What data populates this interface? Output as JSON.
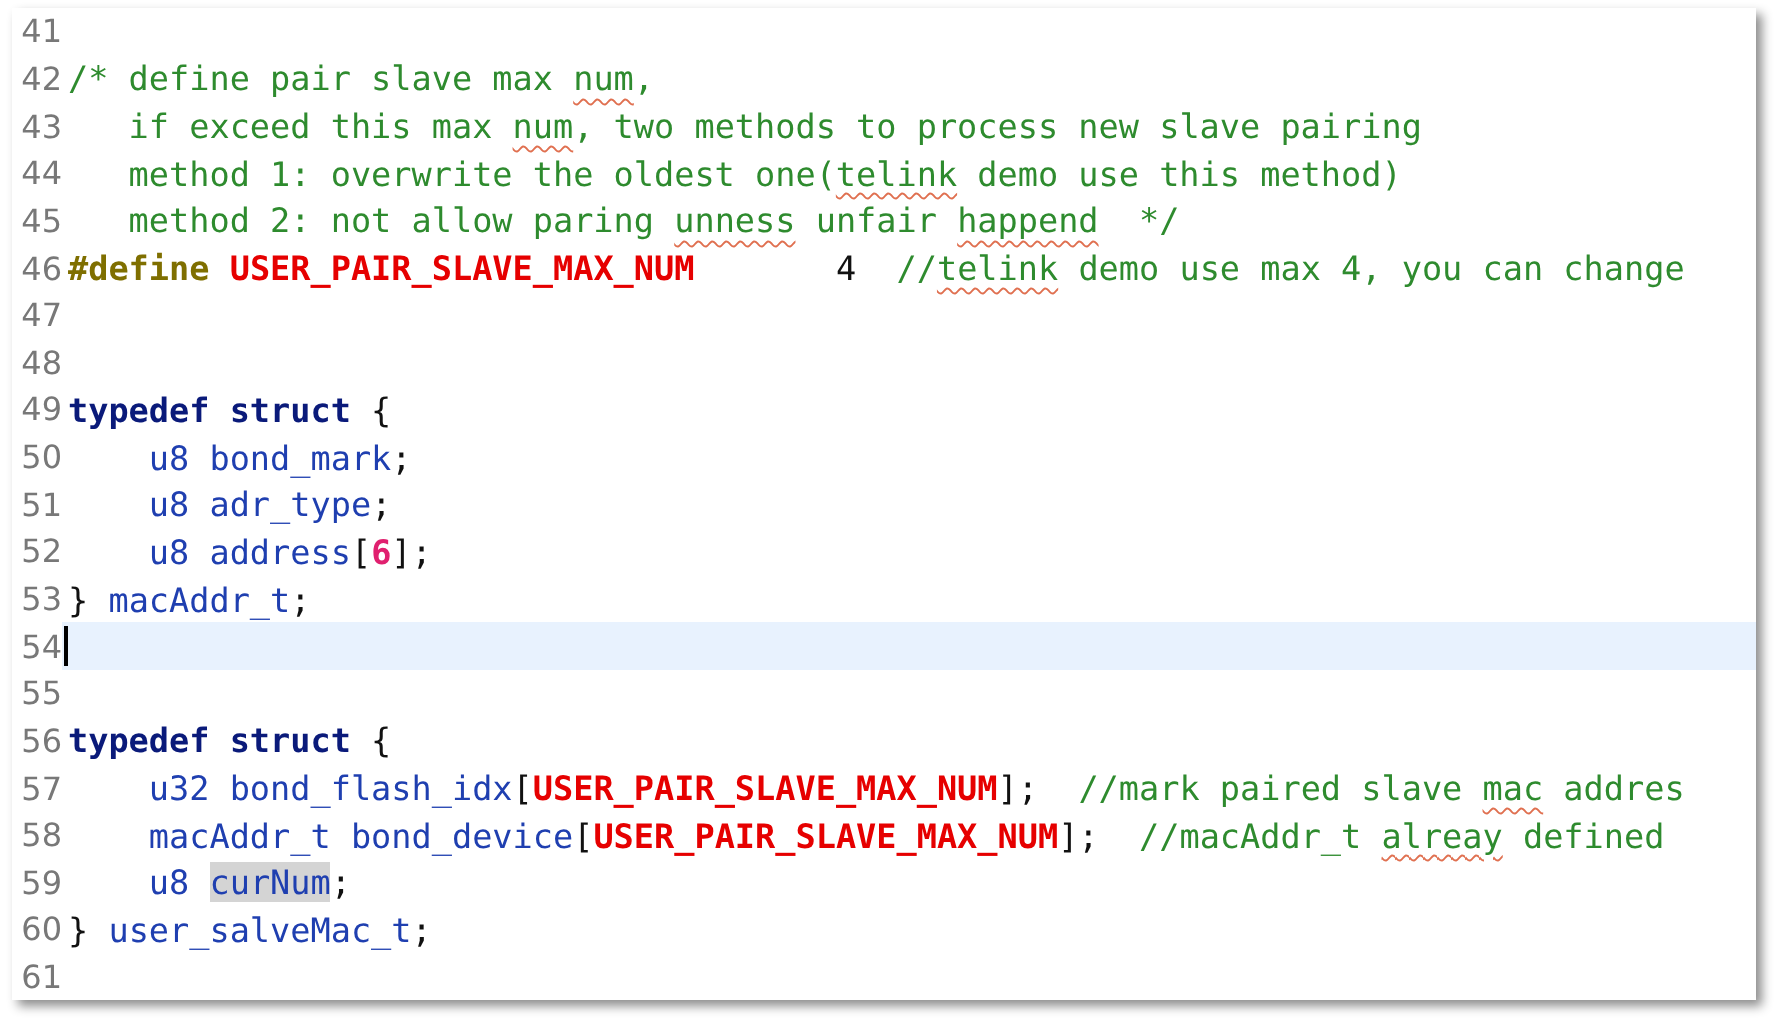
{
  "editor": {
    "lines": [
      {
        "number": "41",
        "current": false
      },
      {
        "number": "42",
        "current": false,
        "tokens": [
          {
            "text": "/* define pair slave max ",
            "kind": "comment",
            "misspelled": false,
            "marked": false
          },
          {
            "text": "num",
            "kind": "comment",
            "misspelled": true,
            "marked": false
          },
          {
            "text": ",",
            "kind": "comment",
            "misspelled": false,
            "marked": false
          }
        ]
      },
      {
        "number": "43",
        "current": false,
        "tokens": [
          {
            "text": "   if exceed this max ",
            "kind": "comment",
            "misspelled": false,
            "marked": false
          },
          {
            "text": "num",
            "kind": "comment",
            "misspelled": true,
            "marked": false
          },
          {
            "text": ", two methods to process new slave pairing",
            "kind": "comment",
            "misspelled": false,
            "marked": false
          }
        ]
      },
      {
        "number": "44",
        "current": false,
        "tokens": [
          {
            "text": "   method 1: overwrite the oldest one(",
            "kind": "comment",
            "misspelled": false,
            "marked": false
          },
          {
            "text": "telink",
            "kind": "comment",
            "misspelled": true,
            "marked": false
          },
          {
            "text": " demo use this method)",
            "kind": "comment",
            "misspelled": false,
            "marked": false
          }
        ]
      },
      {
        "number": "45",
        "current": false,
        "tokens": [
          {
            "text": "   method 2: not allow paring ",
            "kind": "comment",
            "misspelled": false,
            "marked": false
          },
          {
            "text": "unness",
            "kind": "comment",
            "misspelled": true,
            "marked": false
          },
          {
            "text": " unfair ",
            "kind": "comment",
            "misspelled": false,
            "marked": false
          },
          {
            "text": "happend",
            "kind": "comment",
            "misspelled": true,
            "marked": false
          },
          {
            "text": "  */",
            "kind": "comment",
            "misspelled": false,
            "marked": false
          }
        ]
      },
      {
        "number": "46",
        "current": false,
        "tokens": [
          {
            "text": "#define",
            "kind": "directive",
            "misspelled": false,
            "marked": false
          },
          {
            "text": " USER_PAIR_SLAVE_MAX_NUM",
            "kind": "macro",
            "misspelled": false,
            "marked": false
          },
          {
            "text": "       4",
            "kind": "plain",
            "misspelled": false,
            "marked": false
          },
          {
            "text": "  //",
            "kind": "comment",
            "misspelled": false,
            "marked": false
          },
          {
            "text": "telink",
            "kind": "comment",
            "misspelled": true,
            "marked": false
          },
          {
            "text": " demo use max 4, you can change",
            "kind": "comment",
            "misspelled": false,
            "marked": false
          }
        ]
      },
      {
        "number": "47",
        "current": false
      },
      {
        "number": "48",
        "current": false
      },
      {
        "number": "49",
        "current": false,
        "tokens": [
          {
            "text": "typedef struct",
            "kind": "keyword",
            "misspelled": false,
            "marked": false
          },
          {
            "text": " {",
            "kind": "punct",
            "misspelled": false,
            "marked": false
          }
        ]
      },
      {
        "number": "50",
        "current": false,
        "tokens": [
          {
            "text": "    u8 bond_mark",
            "kind": "name",
            "misspelled": false,
            "marked": false
          },
          {
            "text": ";",
            "kind": "punct",
            "misspelled": false,
            "marked": false
          }
        ]
      },
      {
        "number": "51",
        "current": false,
        "tokens": [
          {
            "text": "    u8 adr_type",
            "kind": "name",
            "misspelled": false,
            "marked": false
          },
          {
            "text": ";",
            "kind": "punct",
            "misspelled": false,
            "marked": false
          }
        ]
      },
      {
        "number": "52",
        "current": false,
        "tokens": [
          {
            "text": "    u8 address",
            "kind": "name",
            "misspelled": false,
            "marked": false
          },
          {
            "text": "[",
            "kind": "punct",
            "misspelled": false,
            "marked": false
          },
          {
            "text": "6",
            "kind": "number",
            "misspelled": false,
            "marked": false
          },
          {
            "text": "];",
            "kind": "punct",
            "misspelled": false,
            "marked": false
          }
        ]
      },
      {
        "number": "53",
        "current": false,
        "tokens": [
          {
            "text": "}",
            "kind": "punct",
            "misspelled": false,
            "marked": false
          },
          {
            "text": " macAddr_t",
            "kind": "name",
            "misspelled": false,
            "marked": false
          },
          {
            "text": ";",
            "kind": "punct",
            "misspelled": false,
            "marked": false
          }
        ]
      },
      {
        "number": "54",
        "current": true
      },
      {
        "number": "55",
        "current": false
      },
      {
        "number": "56",
        "current": false,
        "tokens": [
          {
            "text": "typedef struct",
            "kind": "keyword",
            "misspelled": false,
            "marked": false
          },
          {
            "text": " {",
            "kind": "punct",
            "misspelled": false,
            "marked": false
          }
        ]
      },
      {
        "number": "57",
        "current": false,
        "tokens": [
          {
            "text": "    u32 bond_flash_idx",
            "kind": "name",
            "misspelled": false,
            "marked": false
          },
          {
            "text": "[",
            "kind": "punct",
            "misspelled": false,
            "marked": false
          },
          {
            "text": "USER_PAIR_SLAVE_MAX_NUM",
            "kind": "macro",
            "misspelled": false,
            "marked": false
          },
          {
            "text": "];",
            "kind": "punct",
            "misspelled": false,
            "marked": false
          },
          {
            "text": "  //mark paired slave ",
            "kind": "comment",
            "misspelled": false,
            "marked": false
          },
          {
            "text": "mac",
            "kind": "comment",
            "misspelled": true,
            "marked": false
          },
          {
            "text": " addres",
            "kind": "comment",
            "misspelled": false,
            "marked": false
          }
        ]
      },
      {
        "number": "58",
        "current": false,
        "tokens": [
          {
            "text": "    macAddr_t bond_device",
            "kind": "name",
            "misspelled": false,
            "marked": false
          },
          {
            "text": "[",
            "kind": "punct",
            "misspelled": false,
            "marked": false
          },
          {
            "text": "USER_PAIR_SLAVE_MAX_NUM",
            "kind": "macro",
            "misspelled": false,
            "marked": false
          },
          {
            "text": "];",
            "kind": "punct",
            "misspelled": false,
            "marked": false
          },
          {
            "text": "  //macAddr_t ",
            "kind": "comment",
            "misspelled": false,
            "marked": false
          },
          {
            "text": "alreay",
            "kind": "comment",
            "misspelled": true,
            "marked": false
          },
          {
            "text": " defined",
            "kind": "comment",
            "misspelled": false,
            "marked": false
          }
        ]
      },
      {
        "number": "59",
        "current": false,
        "tokens": [
          {
            "text": "    u8 ",
            "kind": "name",
            "misspelled": false,
            "marked": false
          },
          {
            "text": "curNum",
            "kind": "name",
            "misspelled": false,
            "marked": true
          },
          {
            "text": ";",
            "kind": "punct",
            "misspelled": false,
            "marked": false
          }
        ]
      },
      {
        "number": "60",
        "current": false,
        "tokens": [
          {
            "text": "}",
            "kind": "punct",
            "misspelled": false,
            "marked": false
          },
          {
            "text": " user_salveMac_t",
            "kind": "name",
            "misspelled": false,
            "marked": false
          },
          {
            "text": ";",
            "kind": "punct",
            "misspelled": false,
            "marked": false
          }
        ]
      },
      {
        "number": "61",
        "current": false
      }
    ]
  }
}
